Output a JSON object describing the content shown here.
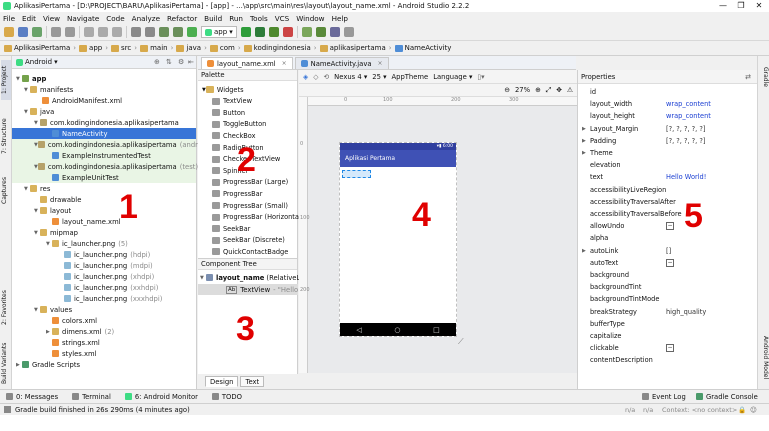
{
  "window": {
    "title": "AplikasiPertama - [D:\\PROJECT\\BARU\\AplikasiPertama] - [app] - ...\\app\\src\\main\\res\\layout\\layout_name.xml - Android Studio 2.2.2",
    "controls": [
      "—",
      "❐",
      "✕"
    ]
  },
  "menu": [
    "File",
    "Edit",
    "View",
    "Navigate",
    "Code",
    "Analyze",
    "Refactor",
    "Build",
    "Run",
    "Tools",
    "VCS",
    "Window",
    "Help"
  ],
  "toolbar": {
    "run_config": "app"
  },
  "breadcrumbs": [
    "AplikasiPertama",
    "app",
    "src",
    "main",
    "java",
    "com",
    "kodingindonesia",
    "aplikasipertama",
    "NameActivity"
  ],
  "left_strip": [
    "1: Project",
    "7: Structure",
    "Captures",
    "2: Favorites",
    "Build Variants"
  ],
  "right_strip": [
    "Gradle",
    "Android Model"
  ],
  "project": {
    "view_selector": "Android",
    "tree": [
      {
        "label": "app",
        "dim": "",
        "icon": "mod",
        "arrow": "▼",
        "bold": true
      },
      {
        "label": "manifests",
        "dim": "",
        "icon": "folder",
        "arrow": "▼"
      },
      {
        "label": "AndroidManifest.xml",
        "dim": "",
        "icon": "xml",
        "arrow": ""
      },
      {
        "label": "java",
        "dim": "",
        "icon": "folder",
        "arrow": "▼"
      },
      {
        "label": "com.kodingindonesia.aplikasipertama",
        "dim": "",
        "icon": "pkg",
        "arrow": "▼"
      },
      {
        "label": "NameActivity",
        "dim": "",
        "icon": "java",
        "arrow": "",
        "selected": true
      },
      {
        "label": "com.kodingindonesia.aplikasipertama",
        "dim": "(android",
        "icon": "pkg",
        "arrow": "▼",
        "green": true
      },
      {
        "label": "ExampleInstrumentedTest",
        "dim": "",
        "icon": "java",
        "arrow": "",
        "green": true
      },
      {
        "label": "com.kodingindonesia.aplikasipertama",
        "dim": "(test)",
        "icon": "pkg",
        "arrow": "▼",
        "green": true
      },
      {
        "label": "ExampleUnitTest",
        "dim": "",
        "icon": "java",
        "arrow": "",
        "green": true
      },
      {
        "label": "res",
        "dim": "",
        "icon": "folder",
        "arrow": "▼"
      },
      {
        "label": "drawable",
        "dim": "",
        "icon": "folder",
        "arrow": ""
      },
      {
        "label": "layout",
        "dim": "",
        "icon": "folder",
        "arrow": "▼"
      },
      {
        "label": "layout_name.xml",
        "dim": "",
        "icon": "xml",
        "arrow": ""
      },
      {
        "label": "mipmap",
        "dim": "",
        "icon": "folder",
        "arrow": "▼"
      },
      {
        "label": "ic_launcher.png",
        "dim": "(5)",
        "icon": "folder",
        "arrow": "▼"
      },
      {
        "label": "ic_launcher.png",
        "dim": "(hdpi)",
        "icon": "img",
        "arrow": ""
      },
      {
        "label": "ic_launcher.png",
        "dim": "(mdpi)",
        "icon": "img",
        "arrow": ""
      },
      {
        "label": "ic_launcher.png",
        "dim": "(xhdpi)",
        "icon": "img",
        "arrow": ""
      },
      {
        "label": "ic_launcher.png",
        "dim": "(xxhdpi)",
        "icon": "img",
        "arrow": ""
      },
      {
        "label": "ic_launcher.png",
        "dim": "(xxxhdpi)",
        "icon": "img",
        "arrow": ""
      },
      {
        "label": "values",
        "dim": "",
        "icon": "folder",
        "arrow": "▼"
      },
      {
        "label": "colors.xml",
        "dim": "",
        "icon": "xml",
        "arrow": ""
      },
      {
        "label": "dimens.xml",
        "dim": "(2)",
        "icon": "folder",
        "arrow": "▶"
      },
      {
        "label": "strings.xml",
        "dim": "",
        "icon": "xml",
        "arrow": ""
      },
      {
        "label": "styles.xml",
        "dim": "",
        "icon": "xml",
        "arrow": ""
      },
      {
        "label": "Gradle Scripts",
        "dim": "",
        "icon": "grad",
        "arrow": "▶"
      }
    ]
  },
  "editor_tabs": [
    {
      "label": "layout_name.xml",
      "active": true
    },
    {
      "label": "NameActivity.java",
      "active": false
    }
  ],
  "palette": {
    "title": "Palette",
    "items": [
      "Widgets",
      "TextView",
      "Button",
      "ToggleButton",
      "CheckBox",
      "RadioButton",
      "CheckedTextView",
      "Spinner",
      "ProgressBar (Large)",
      "ProgressBar",
      "ProgressBar (Small)",
      "ProgressBar (Horizontal)",
      "SeekBar",
      "SeekBar (Discrete)",
      "QuickContactBadge"
    ]
  },
  "component_tree": {
    "title": "Component Tree",
    "root": "layout_name",
    "root_type": "(RelativeLayout)",
    "child": "TextView",
    "child_value": "- \"Hello World!\""
  },
  "design_tabs": [
    "Design",
    "Text"
  ],
  "design_bar": {
    "device": "Nexus 4",
    "api": "25",
    "theme": "AppTheme",
    "language": "Language"
  },
  "zoom": "27%",
  "ruler_labels": [
    "0",
    "100",
    "200",
    "300"
  ],
  "device_preview": {
    "status_time": "6:00",
    "app_title": "Aplikasi Pertama",
    "nav": [
      "◁",
      "○",
      "□"
    ]
  },
  "properties": {
    "title": "Properties",
    "rows": [
      {
        "name": "id",
        "value": "",
        "arrow": ""
      },
      {
        "name": "layout_width",
        "value": "wrap_content",
        "arrow": ""
      },
      {
        "name": "layout_height",
        "value": "wrap_content",
        "arrow": ""
      },
      {
        "name": "Layout_Margin",
        "value": "[?, ?, ?, ?, ?]",
        "arrow": "▶",
        "plain": true
      },
      {
        "name": "Padding",
        "value": "[?, ?, ?, ?, ?]",
        "arrow": "▶",
        "plain": true
      },
      {
        "name": "Theme",
        "value": "",
        "arrow": "▶"
      },
      {
        "name": "elevation",
        "value": "",
        "arrow": ""
      },
      {
        "name": "text",
        "value": "Hello World!",
        "arrow": ""
      },
      {
        "name": "accessibilityLiveRegion",
        "value": "",
        "arrow": ""
      },
      {
        "name": "accessibilityTraversalAfter",
        "value": "",
        "arrow": ""
      },
      {
        "name": "accessibilityTraversalBefore",
        "value": "",
        "arrow": ""
      },
      {
        "name": "allowUndo",
        "value": "",
        "arrow": "",
        "minus": true
      },
      {
        "name": "alpha",
        "value": "",
        "arrow": ""
      },
      {
        "name": "autoLink",
        "value": "[]",
        "arrow": "▶",
        "plain": true
      },
      {
        "name": "autoText",
        "value": "",
        "arrow": "",
        "minus": true
      },
      {
        "name": "background",
        "value": "",
        "arrow": ""
      },
      {
        "name": "backgroundTint",
        "value": "",
        "arrow": ""
      },
      {
        "name": "backgroundTintMode",
        "value": "",
        "arrow": ""
      },
      {
        "name": "breakStrategy",
        "value": "high_quality",
        "arrow": "",
        "plain": true
      },
      {
        "name": "bufferType",
        "value": "",
        "arrow": ""
      },
      {
        "name": "capitalize",
        "value": "",
        "arrow": ""
      },
      {
        "name": "clickable",
        "value": "",
        "arrow": "",
        "minus": true
      },
      {
        "name": "contentDescription",
        "value": "",
        "arrow": ""
      }
    ]
  },
  "bottom_tabs": [
    "0: Messages",
    "Terminal",
    "6: Android Monitor",
    "TODO",
    "Event Log",
    "Gradle Console"
  ],
  "status": {
    "message": "Gradle build finished in 26s 290ms (4 minutes ago)",
    "right1": "n/a",
    "right2": "n/a",
    "context": "Context: <no context>"
  },
  "annotations": [
    "1",
    "2",
    "3",
    "4",
    "5"
  ],
  "colors": {
    "selection": "#3875d7",
    "primary": "#3f51b5",
    "primary_dark": "#303f9f",
    "annotation": "#e00000"
  }
}
